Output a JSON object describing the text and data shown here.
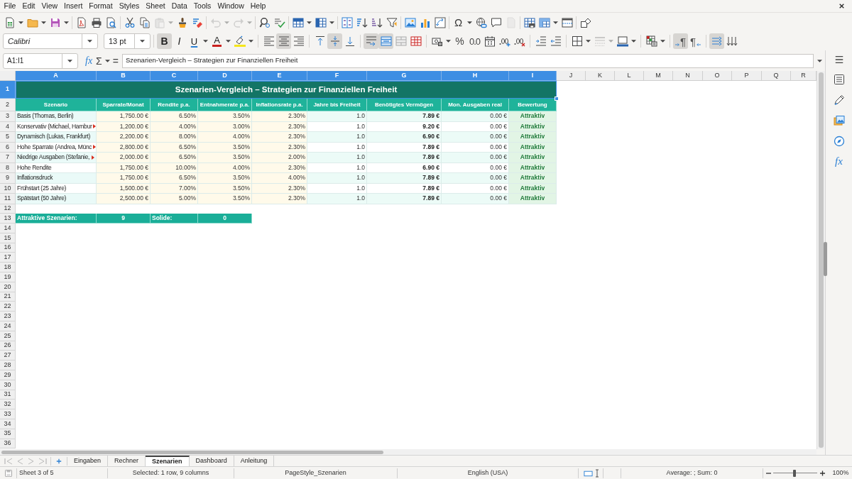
{
  "menu_bar": {
    "items": [
      "File",
      "Edit",
      "View",
      "Insert",
      "Format",
      "Styles",
      "Sheet",
      "Data",
      "Tools",
      "Window",
      "Help"
    ]
  },
  "standard_toolbar": {
    "groups": [
      [
        {
          "kind": "new",
          "disabled": false,
          "dropdown": true
        },
        {
          "kind": "open",
          "disabled": false,
          "dropdown": true
        },
        {
          "kind": "save",
          "disabled": false,
          "dropdown": true
        }
      ],
      [
        {
          "kind": "pdf",
          "disabled": false
        },
        {
          "kind": "print",
          "disabled": false
        },
        {
          "kind": "preview",
          "disabled": false
        }
      ],
      [
        {
          "kind": "cut",
          "disabled": false
        },
        {
          "kind": "copy",
          "disabled": false
        },
        {
          "kind": "paste",
          "disabled": true,
          "dropdown": true
        },
        {
          "kind": "clone",
          "disabled": false
        },
        {
          "kind": "clear",
          "disabled": false
        }
      ],
      [
        {
          "kind": "undo",
          "disabled": true,
          "dropdown": true
        },
        {
          "kind": "redo",
          "disabled": true,
          "dropdown": true
        }
      ],
      [
        {
          "kind": "find",
          "disabled": false
        },
        {
          "kind": "spelling",
          "disabled": false
        }
      ],
      [
        {
          "kind": "rows",
          "disabled": false,
          "dropdown": true
        },
        {
          "kind": "columns",
          "disabled": false,
          "dropdown": true
        }
      ],
      [
        {
          "kind": "sort",
          "disabled": false
        },
        {
          "kind": "ascending",
          "disabled": false
        },
        {
          "kind": "descending",
          "disabled": false
        },
        {
          "kind": "filter",
          "disabled": false
        }
      ],
      [
        {
          "kind": "image",
          "disabled": false
        },
        {
          "kind": "chart",
          "disabled": false
        },
        {
          "kind": "pivot",
          "disabled": false
        }
      ],
      [
        {
          "kind": "symbol",
          "label": "Ω",
          "disabled": false,
          "dropdown": true
        },
        {
          "kind": "link",
          "disabled": false
        },
        {
          "kind": "comment",
          "disabled": false
        },
        {
          "kind": "headers",
          "disabled": true
        }
      ],
      [
        {
          "kind": "print_range",
          "disabled": false
        },
        {
          "kind": "freeze",
          "disabled": false,
          "dropdown": true
        },
        {
          "kind": "split",
          "disabled": false
        }
      ],
      [
        {
          "kind": "shapes",
          "disabled": false
        }
      ]
    ]
  },
  "format_toolbar": {
    "font_name": "Calibri",
    "font_size": "13 pt",
    "groups": [
      [
        {
          "kind": "bold",
          "label": "B",
          "pressed": true,
          "disabled": false
        },
        {
          "kind": "italic",
          "label": "I",
          "pressed": false,
          "disabled": false
        },
        {
          "kind": "underline",
          "label": "U",
          "pressed": false,
          "disabled": false,
          "dropdown": true
        },
        {
          "kind": "font_color",
          "label": "A",
          "pressed": false,
          "disabled": false,
          "dropdown": true
        },
        {
          "kind": "highlight",
          "pressed": false,
          "disabled": false,
          "dropdown": true
        }
      ],
      [
        {
          "kind": "align_left",
          "pressed": false,
          "disabled": false
        },
        {
          "kind": "align_center",
          "pressed": true,
          "disabled": false
        },
        {
          "kind": "align_right",
          "pressed": false,
          "disabled": false
        }
      ],
      [
        {
          "kind": "align_top",
          "pressed": false,
          "disabled": false
        },
        {
          "kind": "align_middle",
          "pressed": true,
          "disabled": false
        },
        {
          "kind": "align_bottom",
          "pressed": false,
          "disabled": false
        }
      ],
      [
        {
          "kind": "wrap",
          "pressed": true,
          "disabled": false
        },
        {
          "kind": "merge_center",
          "pressed": true,
          "disabled": false
        },
        {
          "kind": "merge",
          "pressed": false,
          "disabled": false
        },
        {
          "kind": "unmerge",
          "pressed": false,
          "disabled": false
        }
      ],
      [
        {
          "kind": "currency",
          "pressed": false,
          "disabled": false,
          "dropdown": true
        },
        {
          "kind": "percent",
          "label": "%",
          "pressed": false,
          "disabled": false
        },
        {
          "kind": "number",
          "label": "0.0",
          "pressed": false,
          "disabled": false
        },
        {
          "kind": "date",
          "pressed": false,
          "disabled": false
        },
        {
          "kind": "add_decimal",
          "pressed": false,
          "disabled": false
        },
        {
          "kind": "delete_decimal",
          "pressed": false,
          "disabled": false
        }
      ],
      [
        {
          "kind": "indent",
          "pressed": false,
          "disabled": false
        },
        {
          "kind": "outdent",
          "pressed": false,
          "disabled": false
        }
      ],
      [
        {
          "kind": "borders",
          "pressed": false,
          "disabled": false,
          "dropdown": true
        },
        {
          "kind": "border_style",
          "pressed": false,
          "disabled": true,
          "dropdown": true
        },
        {
          "kind": "border_color",
          "pressed": false,
          "disabled": false,
          "dropdown": true
        }
      ],
      [
        {
          "kind": "conditional",
          "pressed": false,
          "disabled": false,
          "dropdown": true
        }
      ],
      [
        {
          "kind": "ltr",
          "label": "¶",
          "pressed": true,
          "disabled": false
        },
        {
          "kind": "rtl",
          "label": "¶",
          "pressed": false,
          "disabled": false
        }
      ],
      [
        {
          "kind": "text_horizontal",
          "pressed": true,
          "disabled": false
        },
        {
          "kind": "text_vertical",
          "pressed": false,
          "disabled": false
        }
      ]
    ]
  },
  "formula_bar": {
    "name_box": "A1:I1",
    "wizard": "fx",
    "sum": "Σ",
    "equals": "=",
    "content": "Szenarien-Vergleich – Strategien zur Finanziellen Freiheit"
  },
  "sheet": {
    "columns": [
      {
        "label": "A",
        "selected": true
      },
      {
        "label": "B",
        "selected": true
      },
      {
        "label": "C",
        "selected": true
      },
      {
        "label": "D",
        "selected": true
      },
      {
        "label": "E",
        "selected": true
      },
      {
        "label": "F",
        "selected": true
      },
      {
        "label": "G",
        "selected": true
      },
      {
        "label": "H",
        "selected": true
      },
      {
        "label": "I",
        "selected": true
      },
      {
        "label": "J",
        "selected": false
      },
      {
        "label": "K",
        "selected": false
      },
      {
        "label": "L",
        "selected": false
      },
      {
        "label": "M",
        "selected": false
      },
      {
        "label": "N",
        "selected": false
      },
      {
        "label": "O",
        "selected": false
      },
      {
        "label": "P",
        "selected": false
      },
      {
        "label": "Q",
        "selected": false
      },
      {
        "label": "R",
        "selected": false
      }
    ],
    "row_headers": [
      {
        "label": "1",
        "selected": true
      },
      {
        "label": "2",
        "selected": false
      },
      {
        "label": "3",
        "selected": false
      },
      {
        "label": "4",
        "selected": false
      },
      {
        "label": "5",
        "selected": false
      },
      {
        "label": "6",
        "selected": false
      },
      {
        "label": "7",
        "selected": false
      },
      {
        "label": "8",
        "selected": false
      },
      {
        "label": "9",
        "selected": false
      },
      {
        "label": "10",
        "selected": false
      },
      {
        "label": "11",
        "selected": false
      },
      {
        "label": "12",
        "selected": false
      },
      {
        "label": "13",
        "selected": false
      },
      {
        "label": "14",
        "selected": false
      },
      {
        "label": "15",
        "selected": false
      },
      {
        "label": "16",
        "selected": false
      },
      {
        "label": "17",
        "selected": false
      },
      {
        "label": "18",
        "selected": false
      },
      {
        "label": "19",
        "selected": false
      },
      {
        "label": "20",
        "selected": false
      },
      {
        "label": "21",
        "selected": false
      },
      {
        "label": "22",
        "selected": false
      },
      {
        "label": "23",
        "selected": false
      },
      {
        "label": "24",
        "selected": false
      },
      {
        "label": "25",
        "selected": false
      },
      {
        "label": "26",
        "selected": false
      },
      {
        "label": "27",
        "selected": false
      },
      {
        "label": "28",
        "selected": false
      },
      {
        "label": "29",
        "selected": false
      },
      {
        "label": "30",
        "selected": false
      },
      {
        "label": "31",
        "selected": false
      },
      {
        "label": "32",
        "selected": false
      },
      {
        "label": "33",
        "selected": false
      },
      {
        "label": "34",
        "selected": false
      },
      {
        "label": "35",
        "selected": false
      },
      {
        "label": "36",
        "selected": false
      }
    ],
    "title": "Szenarien-Vergleich – Strategien zur Finanziellen Freiheit",
    "header": [
      "Szenario",
      "Sparrate/Monat",
      "Rendite p.a.",
      "Entnahmerate p.a.",
      "Inflationsrate p.a.",
      "Jahre bis Freiheit",
      "Benötigtes Vermögen",
      "Mon. Ausgaben real",
      "Bewertung"
    ],
    "data": [
      {
        "clipped": false,
        "cells": [
          "Basis (Thomas, Berlin)",
          "1,750.00 €",
          "6.50%",
          "3.50%",
          "2.30%",
          "1.0",
          "7.89 €",
          "0.00 €",
          "Attraktiv"
        ]
      },
      {
        "clipped": true,
        "cells": [
          "Konservativ (Michael, Hambur",
          "1,200.00 €",
          "4.00%",
          "3.00%",
          "2.30%",
          "1.0",
          "9.20 €",
          "0.00 €",
          "Attraktiv"
        ]
      },
      {
        "clipped": false,
        "cells": [
          "Dynamisch (Lukas, Frankfurt)",
          "2,200.00 €",
          "8.00%",
          "4.00%",
          "2.30%",
          "1.0",
          "6.90 €",
          "0.00 €",
          "Attraktiv"
        ]
      },
      {
        "clipped": true,
        "cells": [
          "Hohe Sparrate (Andrea, Münc",
          "2,800.00 €",
          "6.50%",
          "3.50%",
          "2.30%",
          "1.0",
          "7.89 €",
          "0.00 €",
          "Attraktiv"
        ]
      },
      {
        "clipped": true,
        "cells": [
          "Niedrige Ausgaben (Stefanie,",
          "2,000.00 €",
          "6.50%",
          "3.50%",
          "2.00%",
          "1.0",
          "7.89 €",
          "0.00 €",
          "Attraktiv"
        ]
      },
      {
        "clipped": false,
        "cells": [
          "Hohe Rendite",
          "1,750.00 €",
          "10.00%",
          "4.00%",
          "2.30%",
          "1.0",
          "6.90 €",
          "0.00 €",
          "Attraktiv"
        ]
      },
      {
        "clipped": false,
        "cells": [
          "Inflationsdruck",
          "1,750.00 €",
          "6.50%",
          "3.50%",
          "4.00%",
          "1.0",
          "7.89 €",
          "0.00 €",
          "Attraktiv"
        ]
      },
      {
        "clipped": false,
        "cells": [
          "Frühstart (25 Jahre)",
          "1,500.00 €",
          "7.00%",
          "3.50%",
          "2.30%",
          "1.0",
          "7.89 €",
          "0.00 €",
          "Attraktiv"
        ]
      },
      {
        "clipped": false,
        "cells": [
          "Spätstart (50 Jahre)",
          "2,500.00 €",
          "5.00%",
          "3.50%",
          "2.30%",
          "1.0",
          "7.89 €",
          "0.00 €",
          "Attraktiv"
        ]
      }
    ],
    "summary": [
      "Attraktive Szenarien:",
      "9",
      "Solide:",
      "0"
    ]
  },
  "sidebar": {
    "functions": "fx"
  },
  "sheet_tabs": {
    "tabs": [
      {
        "label": "Eingaben",
        "selected": false
      },
      {
        "label": "Rechner",
        "selected": false
      },
      {
        "label": "Szenarien",
        "selected": true
      },
      {
        "label": "Dashboard",
        "selected": false
      },
      {
        "label": "Anleitung",
        "selected": false
      }
    ]
  },
  "status_bar": {
    "sheet": "Sheet 3 of 5",
    "selection": "Selected: 1 row, 9 columns",
    "page_style": "PageStyle_Szenarien",
    "language": "English (USA)",
    "sum": "Average: ; Sum: 0",
    "zoom": {
      "level": 0.48,
      "reading": "100%"
    }
  }
}
